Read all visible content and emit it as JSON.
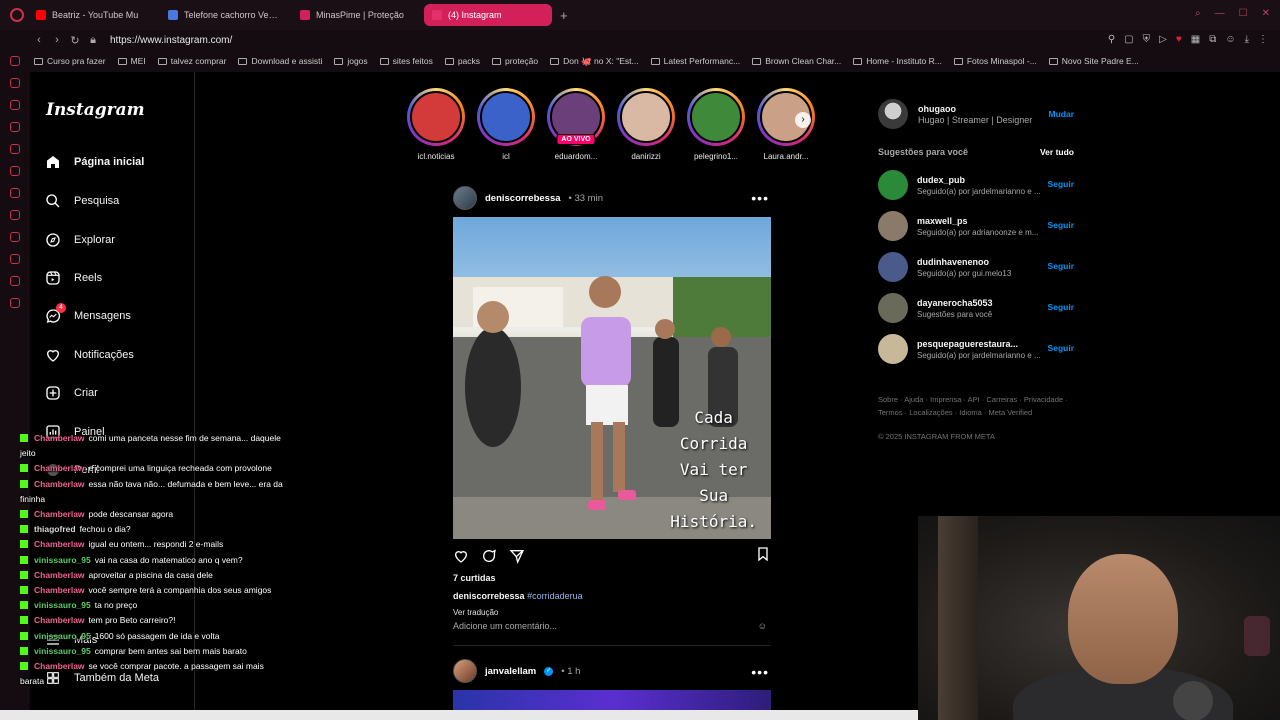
{
  "browser": {
    "tabs": [
      {
        "label": "Beatriz - YouTube Mu",
        "color": "#ff0000"
      },
      {
        "label": "Telefone cachorro Vector",
        "color": "#4a78e0"
      },
      {
        "label": "MinasPime | Proteção",
        "color": "#d3205b"
      },
      {
        "label": "(4) Instagram",
        "color": "#e1306c"
      }
    ],
    "new_tab": "+",
    "url": "https://www.instagram.com/",
    "bookmarks": [
      "Curso pra fazer",
      "MEI",
      "talvez comprar",
      "Download e assisti",
      "jogos",
      "sites feitos",
      "packs",
      "proteção",
      "Don 🐙 no X: \"Est...",
      "Latest Performanc...",
      "Brown Clean Char...",
      "Home - Instituto R...",
      "Fotos Minaspol -...",
      "Novo Site Padre E..."
    ]
  },
  "nav": {
    "logo": "Instagram",
    "items": [
      {
        "label": "Página inicial",
        "icon": "home-icon"
      },
      {
        "label": "Pesquisa",
        "icon": "search-icon"
      },
      {
        "label": "Explorar",
        "icon": "compass-icon"
      },
      {
        "label": "Reels",
        "icon": "reels-icon"
      },
      {
        "label": "Mensagens",
        "icon": "messenger-icon",
        "badge": "4"
      },
      {
        "label": "Notificações",
        "icon": "heart-icon"
      },
      {
        "label": "Criar",
        "icon": "plus-square-icon"
      },
      {
        "label": "Painel",
        "icon": "chart-icon"
      },
      {
        "label": "Perfil",
        "icon": "profile-icon"
      },
      {
        "label": "Mais",
        "icon": "menu-icon"
      },
      {
        "label": "Também da Meta",
        "icon": "meta-icon"
      }
    ]
  },
  "stories": {
    "items": [
      {
        "name": "icl.noticias",
        "color": "#d33b3b"
      },
      {
        "name": "icl",
        "color": "#3a62c9"
      },
      {
        "name": "eduardom...",
        "color": "#6b3f7a",
        "live": "AO VIVO"
      },
      {
        "name": "danirizzi",
        "color": "#d9b9a3"
      },
      {
        "name": "pelegrino1...",
        "color": "#3e8a3a"
      },
      {
        "name": "Laura.andr...",
        "color": "#caa086"
      }
    ],
    "next_label": "›"
  },
  "post": {
    "user": "deniscorrebessa",
    "time": "• 33 min",
    "more": "•••",
    "overlay_lines": [
      "Cada",
      "Corrida",
      "Vai ter",
      "Sua",
      "História."
    ],
    "likes": "7 curtidas",
    "caption_user": "deniscorrebessa",
    "caption_tag": "#corridaderua",
    "translate": "Ver tradução",
    "comment_placeholder": "Adicione um comentário..."
  },
  "post2": {
    "user": "janvalellam",
    "time": "• 1 h",
    "more": "•••"
  },
  "account": {
    "username": "ohugaoo",
    "name": "Hugao | Streamer | Designer",
    "switch": "Mudar"
  },
  "suggestions": {
    "title": "Sugestões para você",
    "see_all": "Ver tudo",
    "follow": "Seguir",
    "items": [
      {
        "user": "dudex_pub",
        "sub": "Seguido(a) por jardelmarianno e ...",
        "color": "#2a8a3a"
      },
      {
        "user": "maxwell_ps",
        "sub": "Seguido(a) por adrianoonze e m...",
        "color": "#8a7a6a"
      },
      {
        "user": "dudinhavenenoo",
        "sub": "Seguido(a) por gui.melo13",
        "color": "#4a5a8a"
      },
      {
        "user": "dayanerocha5053",
        "sub": "Sugestões para você",
        "color": "#6a6a5a"
      },
      {
        "user": "pesquepaguerestaura...",
        "sub": "Seguido(a) por jardelmarianno e ...",
        "color": "#c8b89a"
      }
    ]
  },
  "footer": {
    "links": "Sobre · Ajuda · Imprensa · API · Carreiras · Privacidade · Termos · Localizações · Idioma · Meta Verified",
    "copyright": "© 2025 INSTAGRAM FROM META"
  },
  "chat": [
    {
      "user": "Chamberlaw",
      "msg": "comi uma panceta nesse fim de semana... daquele jeito",
      "cls": ""
    },
    {
      "user": "Chamberlaw",
      "msg": "e comprei uma linguiça recheada com provolone",
      "cls": ""
    },
    {
      "user": "Chamberlaw",
      "msg": "essa não tava não... defumada e bem leve... era da fininha",
      "cls": ""
    },
    {
      "user": "Chamberlaw",
      "msg": "pode descansar agora",
      "cls": ""
    },
    {
      "user": "thiagofred",
      "msg": "fechou o dia?",
      "cls": "t"
    },
    {
      "user": "Chamberlaw",
      "msg": "igual eu ontem... respondi 2 e-mails",
      "cls": ""
    },
    {
      "user": "vinissauro_95",
      "msg": "vai na casa do matematico ano q vem?",
      "cls": "v"
    },
    {
      "user": "Chamberlaw",
      "msg": "aproveitar a piscina da casa dele",
      "cls": ""
    },
    {
      "user": "Chamberlaw",
      "msg": "você sempre terá a companhia dos seus amigos",
      "cls": ""
    },
    {
      "user": "vinissauro_95",
      "msg": "ta no preço",
      "cls": "v"
    },
    {
      "user": "Chamberlaw",
      "msg": "tem pro Beto carreiro?!",
      "cls": ""
    },
    {
      "user": "vinissauro_95",
      "msg": "1600 só passagem de ida e volta",
      "cls": "v"
    },
    {
      "user": "vinissauro_95",
      "msg": "comprar bem antes sai bem mais barato",
      "cls": "v"
    },
    {
      "user": "Chamberlaw",
      "msg": "se você comprar pacote. a passagem sai mais barata",
      "cls": ""
    }
  ]
}
